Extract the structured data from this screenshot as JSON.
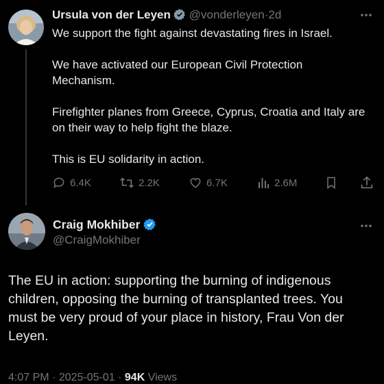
{
  "original_tweet": {
    "author_name": "Ursula von der Leyen",
    "handle": "@vonderleyen",
    "separator": "·",
    "time_ago": "2d",
    "paragraphs": [
      "We support the fight against devastating fires in Israel.",
      "We have activated our European Civil Protection Mechanism.",
      "Firefighter planes from Greece, Cyprus, Croatia and Italy are on their way to help fight the blaze.",
      "This is EU solidarity in action."
    ],
    "actions": {
      "replies": "6.4K",
      "reposts": "2.2K",
      "likes": "6.7K",
      "views": "2.6M"
    },
    "badge_color": "#829aab"
  },
  "reply_tweet": {
    "author_name": "Craig Mokhiber",
    "handle": "@CraigMokhiber",
    "text": "The EU in action: supporting the burning of indigenous children, opposing the burning of transplanted trees. You must be very proud of your place in history, Frau Von der Leyen.",
    "badge_color": "#1d9bf0",
    "meta": {
      "time": "4:07 PM",
      "separator": "·",
      "date": "2025-05-01",
      "separator2": "·",
      "views_count": "94K",
      "views_label": "Views"
    }
  }
}
